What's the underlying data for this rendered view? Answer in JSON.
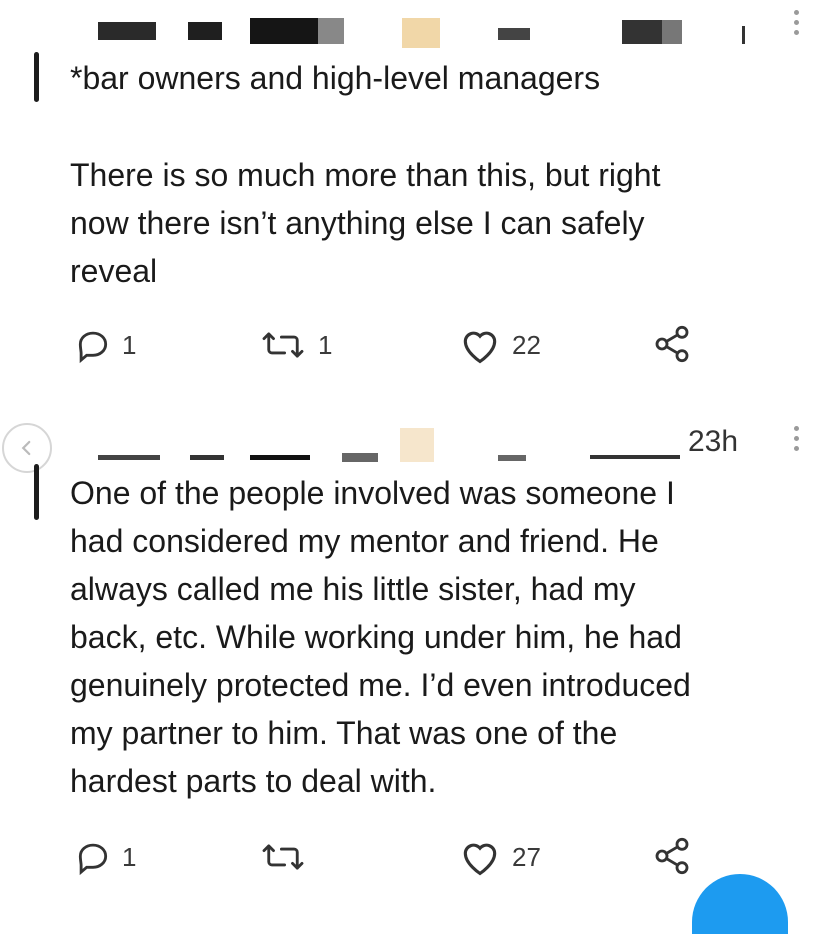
{
  "tweet1": {
    "text_line1": "*bar owners and high-level managers",
    "text_body": "There is so much more than this, but right\nnow there isn’t anything else I can safely\nreveal",
    "replies": "1",
    "retweets": "1",
    "likes": "22",
    "icons": [
      "reply-icon",
      "retweet-icon",
      "like-icon",
      "share-icon",
      "more-icon"
    ]
  },
  "tweet2": {
    "timestamp": "23h",
    "text_body": "One of the people involved was someone I\nhad considered my mentor and friend. He\nalways called me his little sister, had my\nback, etc. While working under him, he had\ngenuinely protected me. I’d even introduced\nmy partner to him. That was one of the\nhardest parts to deal with.",
    "replies": "1",
    "retweets": "",
    "likes": "27",
    "icons": [
      "reply-icon",
      "retweet-icon",
      "like-icon",
      "share-icon",
      "more-icon"
    ]
  },
  "colors": {
    "accent": "#1d9bf0",
    "text": "#1a1a1a",
    "muted": "#3a3a3a"
  }
}
